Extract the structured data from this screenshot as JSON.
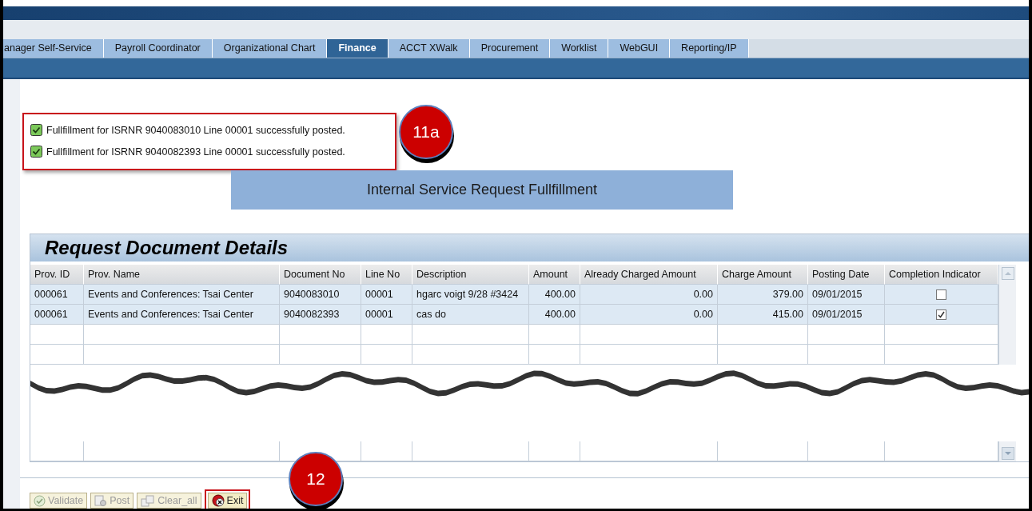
{
  "tabs": [
    {
      "label": "anager Self-Service",
      "selected": false
    },
    {
      "label": "Payroll Coordinator",
      "selected": false
    },
    {
      "label": "Organizational Chart",
      "selected": false
    },
    {
      "label": "Finance",
      "selected": true
    },
    {
      "label": "ACCT XWalk",
      "selected": false
    },
    {
      "label": "Procurement",
      "selected": false
    },
    {
      "label": "Worklist",
      "selected": false
    },
    {
      "label": "WebGUI",
      "selected": false
    },
    {
      "label": "Reporting/IP",
      "selected": false
    }
  ],
  "messages": [
    {
      "text": "Fullfillment for ISRNR 9040083010 Line 00001 successfully posted."
    },
    {
      "text": "Fullfillment for ISRNR 9040082393 Line 00001 successfully posted."
    }
  ],
  "callouts": [
    {
      "label": "11a"
    },
    {
      "label": "12"
    }
  ],
  "page_title": "Internal Service Request Fullfillment",
  "table": {
    "title": "Request Document Details",
    "columns": [
      "Prov. ID",
      "Prov. Name",
      "Document No",
      "Line No",
      "Description",
      "Amount",
      "Already Charged Amount",
      "Charge Amount",
      "Posting Date",
      "Completion Indicator"
    ],
    "rows": [
      {
        "cells": [
          "000061",
          "Events and Conferences: Tsai Center",
          "9040083010",
          "00001",
          "hgarc voigt 9/28 #3424",
          "400.00",
          "0.00",
          "379.00",
          "09/01/2015"
        ],
        "completed": false
      },
      {
        "cells": [
          "000061",
          "Events and Conferences: Tsai Center",
          "9040082393",
          "00001",
          "cas do",
          "400.00",
          "0.00",
          "415.00",
          "09/01/2015"
        ],
        "completed": true
      }
    ]
  },
  "buttons": [
    {
      "kind": "validate",
      "label": "Validate",
      "disabled": true,
      "highlighted": false
    },
    {
      "kind": "post",
      "label": "Post",
      "disabled": true,
      "highlighted": false
    },
    {
      "kind": "clear",
      "label": "Clear_all",
      "disabled": true,
      "highlighted": false
    },
    {
      "kind": "exit",
      "label": "Exit",
      "disabled": false,
      "highlighted": true
    }
  ]
}
